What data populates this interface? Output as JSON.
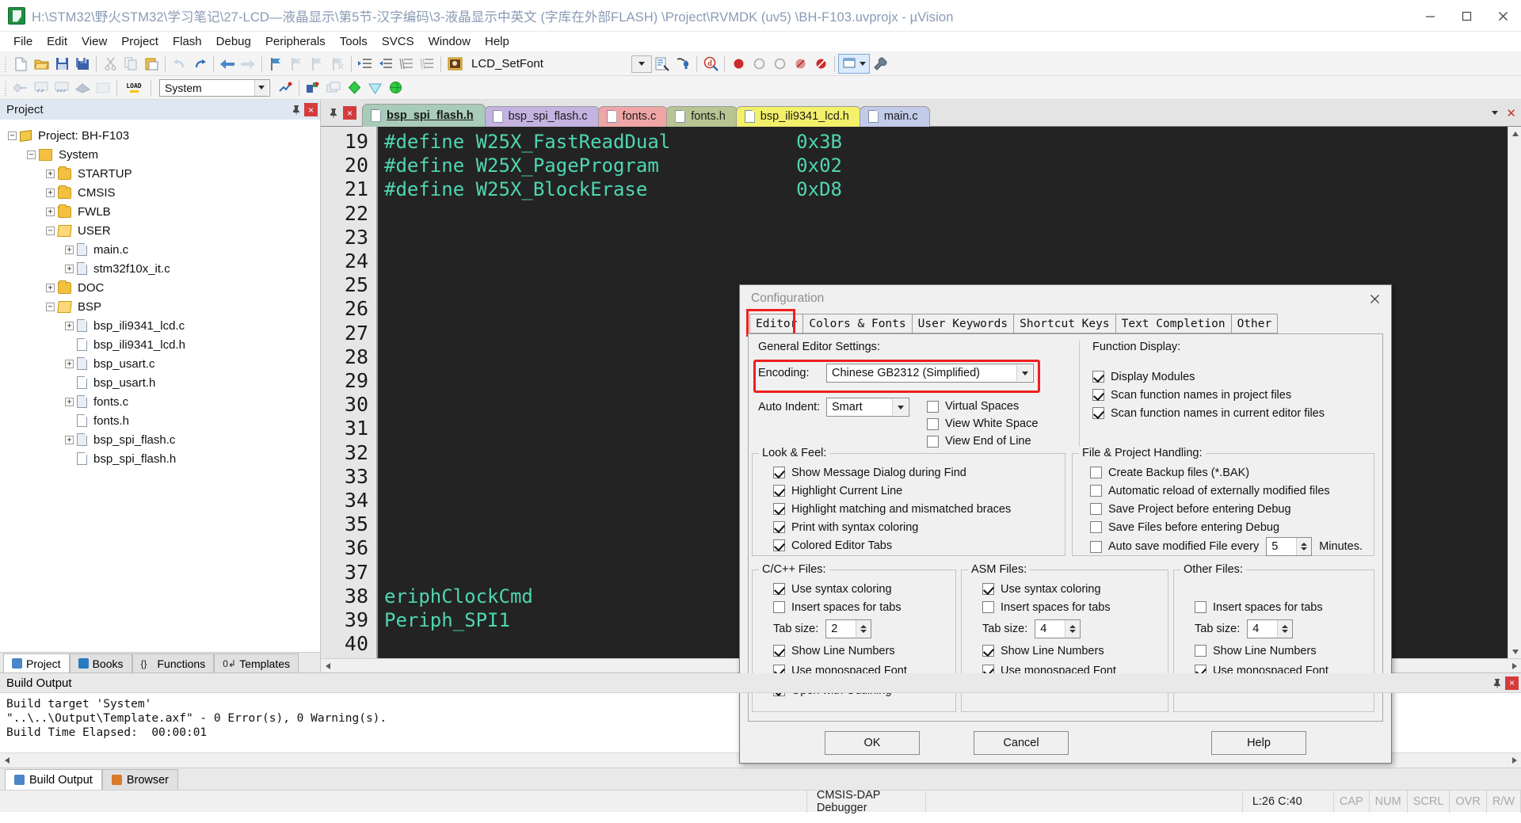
{
  "window": {
    "title": "H:\\STM32\\野火STM32\\学习笔记\\27-LCD—液晶显示\\第5节-汉字编码\\3-液晶显示中英文 (字库在外部FLASH) \\Project\\RVMDK (uv5) \\BH-F103.uvprojx - µVision",
    "minimize": "minimize-icon",
    "maximize": "maximize-icon",
    "close": "close-icon"
  },
  "menubar": [
    "File",
    "Edit",
    "View",
    "Project",
    "Flash",
    "Debug",
    "Peripherals",
    "Tools",
    "SVCS",
    "Window",
    "Help"
  ],
  "toolbar1": {
    "function_combo_value": "LCD_SetFont",
    "icons": [
      "new-file-icon",
      "open-file-icon",
      "save-icon",
      "save-all-icon",
      "cut-icon",
      "copy-icon",
      "paste-icon",
      "undo-icon",
      "redo-icon",
      "back-icon",
      "forward-icon",
      "bookmark-toggle-icon",
      "bookmark-prev-icon",
      "bookmark-next-icon",
      "bookmark-clear-icon",
      "indent-icon",
      "outdent-icon",
      "comment-icon",
      "uncomment-icon",
      "find-in-files-icon"
    ]
  },
  "toolbar2": {
    "target_combo_value": "System",
    "icons": [
      "translate-icon",
      "build-icon",
      "rebuild-icon",
      "batch-build-icon",
      "stop-build-icon",
      "load-icon",
      "target-options-icon",
      "manage-runtime-icon",
      "debug-icon",
      "insert-bookmark-icon",
      "configure-icon"
    ]
  },
  "project_pane": {
    "title": "Project",
    "pin": "pin-icon",
    "close": "close-icon",
    "tree": [
      {
        "label": "Project: BH-F103",
        "depth": 0,
        "expander": "−",
        "icon": "project-icon"
      },
      {
        "label": "System",
        "depth": 1,
        "expander": "−",
        "icon": "target-icon"
      },
      {
        "label": "STARTUP",
        "depth": 2,
        "expander": "+",
        "icon": "folder-icon"
      },
      {
        "label": "CMSIS",
        "depth": 2,
        "expander": "+",
        "icon": "folder-icon"
      },
      {
        "label": "FWLB",
        "depth": 2,
        "expander": "+",
        "icon": "folder-icon"
      },
      {
        "label": "USER",
        "depth": 2,
        "expander": "−",
        "icon": "folder-open-icon"
      },
      {
        "label": "main.c",
        "depth": 3,
        "expander": "+",
        "icon": "c-file-icon"
      },
      {
        "label": "stm32f10x_it.c",
        "depth": 3,
        "expander": "+",
        "icon": "c-file-icon"
      },
      {
        "label": "DOC",
        "depth": 2,
        "expander": "+",
        "icon": "folder-icon"
      },
      {
        "label": "BSP",
        "depth": 2,
        "expander": "−",
        "icon": "folder-open-icon"
      },
      {
        "label": "bsp_ili9341_lcd.c",
        "depth": 3,
        "expander": "+",
        "icon": "c-file-icon"
      },
      {
        "label": "bsp_ili9341_lcd.h",
        "depth": 3,
        "expander": "",
        "icon": "h-file-icon"
      },
      {
        "label": "bsp_usart.c",
        "depth": 3,
        "expander": "+",
        "icon": "c-file-icon"
      },
      {
        "label": "bsp_usart.h",
        "depth": 3,
        "expander": "",
        "icon": "h-file-icon"
      },
      {
        "label": "fonts.c",
        "depth": 3,
        "expander": "+",
        "icon": "c-file-icon"
      },
      {
        "label": "fonts.h",
        "depth": 3,
        "expander": "",
        "icon": "h-file-icon"
      },
      {
        "label": "bsp_spi_flash.c",
        "depth": 3,
        "expander": "+",
        "icon": "c-file-icon"
      },
      {
        "label": "bsp_spi_flash.h",
        "depth": 3,
        "expander": "",
        "icon": "h-file-icon"
      }
    ],
    "tabs": [
      {
        "label": "Project",
        "active": true,
        "icon": "project-icon",
        "color": "#3a7fd5"
      },
      {
        "label": "Books",
        "active": false,
        "icon": "books-icon",
        "color": "#2a7ac0"
      },
      {
        "label": "Functions",
        "active": false,
        "icon": "braces-icon",
        "color": "#333333"
      },
      {
        "label": "Templates",
        "active": false,
        "icon": "template-icon",
        "color": "#333333"
      }
    ]
  },
  "editor": {
    "tabs": [
      {
        "label": "bsp_spi_flash.h",
        "active": true,
        "color": "#a8ccb8"
      },
      {
        "label": "bsp_spi_flash.c",
        "active": false,
        "color": "#c4b2e0"
      },
      {
        "label": "fonts.c",
        "active": false,
        "color": "#f0a6a6"
      },
      {
        "label": "fonts.h",
        "active": false,
        "color": "#b9c493"
      },
      {
        "label": "bsp_ili9341_lcd.h",
        "active": false,
        "color": "#f3f06a"
      },
      {
        "label": "main.c",
        "active": false,
        "color": "#c2cbe8"
      }
    ],
    "line_start": 19,
    "line_end": 40,
    "lines": [
      {
        "n": 19,
        "code": "#define W25X_FastReadDual",
        "value": "0x3B"
      },
      {
        "n": 20,
        "code": "#define W25X_PageProgram",
        "value": "0x02"
      },
      {
        "n": 21,
        "code": "#define W25X_BlockErase",
        "value": "0xD8"
      },
      {
        "n": 22,
        "code": "",
        "value": ""
      },
      {
        "n": 23,
        "code": "",
        "value": ""
      },
      {
        "n": 24,
        "code": "",
        "value": ""
      },
      {
        "n": 25,
        "code": "",
        "value": ""
      },
      {
        "n": 26,
        "code": "",
        "value": ""
      },
      {
        "n": 27,
        "code": "",
        "value": ""
      },
      {
        "n": 28,
        "code": "",
        "value": ""
      },
      {
        "n": 29,
        "code": "",
        "value": ""
      },
      {
        "n": 30,
        "code": "",
        "value": ""
      },
      {
        "n": 31,
        "code": "",
        "value": ""
      },
      {
        "n": 32,
        "code": "",
        "value": ""
      },
      {
        "n": 33,
        "code": "",
        "value": ""
      },
      {
        "n": 34,
        "code": "",
        "value": ""
      },
      {
        "n": 35,
        "code": "",
        "value": ""
      },
      {
        "n": 36,
        "code": "",
        "value": ""
      },
      {
        "n": 37,
        "code": "",
        "value": ""
      },
      {
        "n": 38,
        "code": "eriphClockCmd",
        "value": ""
      },
      {
        "n": 39,
        "code": "Periph_SPI1",
        "value": ""
      },
      {
        "n": 40,
        "code": "",
        "value": ""
      }
    ],
    "visible_fragment_1": "eriphClockCmd",
    "visible_fragment_2": "Periph_SPI1"
  },
  "dialog": {
    "title": "Configuration",
    "close": "close-icon",
    "tabs": [
      {
        "label": "Editor",
        "selected": true,
        "highlighted": true
      },
      {
        "label": "Colors & Fonts",
        "selected": false,
        "highlighted": false
      },
      {
        "label": "User Keywords",
        "selected": false,
        "highlighted": false
      },
      {
        "label": "Shortcut Keys",
        "selected": false,
        "highlighted": false
      },
      {
        "label": "Text Completion",
        "selected": false,
        "highlighted": false
      },
      {
        "label": "Other",
        "selected": false,
        "highlighted": false
      }
    ],
    "general": {
      "title": "General Editor Settings:",
      "encoding_label": "Encoding:",
      "encoding_value": "Chinese GB2312 (Simplified)",
      "auto_indent_label": "Auto Indent:",
      "auto_indent_value": "Smart",
      "checks": [
        {
          "label": "Virtual Spaces",
          "checked": false
        },
        {
          "label": "View White Space",
          "checked": false
        },
        {
          "label": "View End of Line",
          "checked": false
        }
      ]
    },
    "function_display": {
      "title": "Function Display:",
      "checks": [
        {
          "label": "Display Modules",
          "checked": true
        },
        {
          "label": "Scan function names in project files",
          "checked": true
        },
        {
          "label": "Scan function names in current editor files",
          "checked": true
        }
      ]
    },
    "look_feel": {
      "title": "Look & Feel:",
      "checks": [
        {
          "label": "Show Message Dialog during Find",
          "checked": true
        },
        {
          "label": "Highlight Current Line",
          "checked": true
        },
        {
          "label": "Highlight matching and mismatched braces",
          "checked": true
        },
        {
          "label": "Print with syntax coloring",
          "checked": true
        },
        {
          "label": "Colored Editor Tabs",
          "checked": true
        }
      ]
    },
    "file_project": {
      "title": "File & Project Handling:",
      "checks": [
        {
          "label": "Create Backup files (*.BAK)",
          "checked": false
        },
        {
          "label": "Automatic reload of externally modified files",
          "checked": false
        },
        {
          "label": "Save Project before entering Debug",
          "checked": false
        },
        {
          "label": "Save Files before entering Debug",
          "checked": false
        },
        {
          "label": "Auto save modified File every",
          "checked": false
        }
      ],
      "autosave_value": "5",
      "autosave_units": "Minutes."
    },
    "c_files": {
      "title": "C/C++ Files:",
      "checks": [
        {
          "label": "Use syntax coloring",
          "checked": true
        },
        {
          "label": "Insert spaces for tabs",
          "checked": false
        }
      ],
      "tab_label": "Tab size:",
      "tab_value": "2",
      "checks2": [
        {
          "label": "Show Line Numbers",
          "checked": true
        },
        {
          "label": "Use monospaced Font",
          "checked": true
        },
        {
          "label": "Open with Outlining",
          "checked": true
        }
      ]
    },
    "asm_files": {
      "title": "ASM Files:",
      "checks": [
        {
          "label": "Use syntax coloring",
          "checked": true
        },
        {
          "label": "Insert spaces for tabs",
          "checked": false
        }
      ],
      "tab_label": "Tab size:",
      "tab_value": "4",
      "checks2": [
        {
          "label": "Show Line Numbers",
          "checked": true
        },
        {
          "label": "Use monospaced Font",
          "checked": true
        }
      ]
    },
    "other_files": {
      "title": "Other Files:",
      "checks": [
        {
          "label": "Insert spaces for tabs",
          "checked": false
        }
      ],
      "tab_label": "Tab size:",
      "tab_value": "4",
      "checks2": [
        {
          "label": "Show Line Numbers",
          "checked": false
        },
        {
          "label": "Use monospaced Font",
          "checked": true
        }
      ]
    },
    "buttons": {
      "ok": "OK",
      "cancel": "Cancel",
      "help": "Help"
    }
  },
  "build_output": {
    "title": "Build Output",
    "pin": "pin-icon",
    "close": "close-icon",
    "lines": [
      "Build target 'System'",
      "\"..\\..\\Output\\Template.axf\" - 0 Error(s), 0 Warning(s).",
      "Build Time Elapsed:  00:00:01"
    ],
    "tabs": [
      {
        "label": "Build Output",
        "active": true,
        "icon": "build-output-icon"
      },
      {
        "label": "Browser",
        "active": false,
        "icon": "browser-icon"
      }
    ]
  },
  "status": {
    "debugger": "CMSIS-DAP Debugger",
    "cursor": "L:26 C:40",
    "flags": [
      "CAP",
      "NUM",
      "SCRL",
      "OVR",
      "R/W"
    ]
  },
  "colors": {
    "accent_red": "#ef1f1f",
    "title_text": "#8a9bb5",
    "code_bg": "#232323",
    "code_fg": "#4fd6b0"
  }
}
